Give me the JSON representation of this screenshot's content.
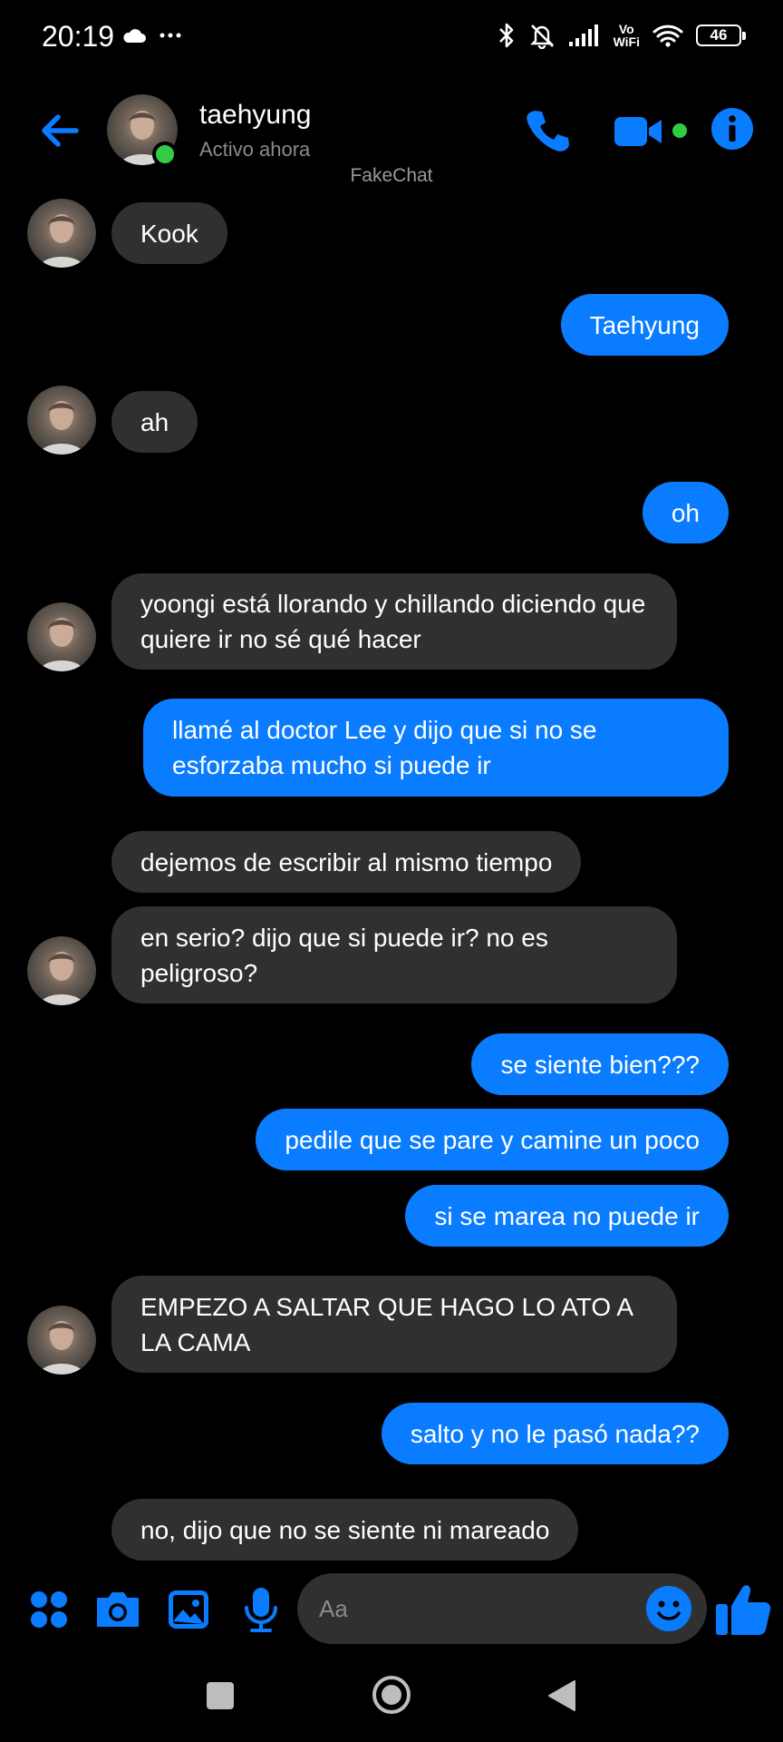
{
  "status_bar": {
    "time": "20:19",
    "vowifi_top": "Vo",
    "vowifi_bottom": "WiFi",
    "battery": "46"
  },
  "header": {
    "contact_name": "taehyung",
    "contact_status": "Activo ahora"
  },
  "watermark": "FakeChat",
  "messages": [
    {
      "side": "in",
      "text": "Kook"
    },
    {
      "side": "out",
      "text": "Taehyung"
    },
    {
      "side": "in",
      "text": "ah"
    },
    {
      "side": "out",
      "text": "oh"
    },
    {
      "side": "in",
      "text": "yoongi está llorando y chillando diciendo que quiere ir no sé qué hacer"
    },
    {
      "side": "out",
      "text": "llamé al doctor Lee y dijo que si no se esforzaba mucho si puede ir"
    },
    {
      "side": "in",
      "text": "dejemos de escribir al mismo tiempo"
    },
    {
      "side": "in",
      "text": "en serio? dijo que si puede ir? no es peligroso?"
    },
    {
      "side": "out",
      "text": "se siente bien???"
    },
    {
      "side": "out",
      "text": "pedile que se pare y camine un poco"
    },
    {
      "side": "out",
      "text": "si se marea no puede ir"
    },
    {
      "side": "in",
      "text": "EMPEZO A SALTAR QUE HAGO LO ATO A LA CAMA"
    },
    {
      "side": "out",
      "text": "salto y no le pasó nada??"
    },
    {
      "side": "in",
      "text": "no, dijo que no se siente ni mareado"
    }
  ],
  "composer": {
    "placeholder": "Aa"
  },
  "colors": {
    "accent": "#0a7cff",
    "incoming_bubble": "#303030",
    "online": "#31cc46",
    "background": "#000000"
  },
  "icons": [
    "back-arrow-icon",
    "phone-icon",
    "video-camera-icon",
    "info-icon",
    "apps-grid-icon",
    "camera-icon",
    "gallery-icon",
    "microphone-icon",
    "emoji-icon",
    "thumbs-up-icon"
  ]
}
